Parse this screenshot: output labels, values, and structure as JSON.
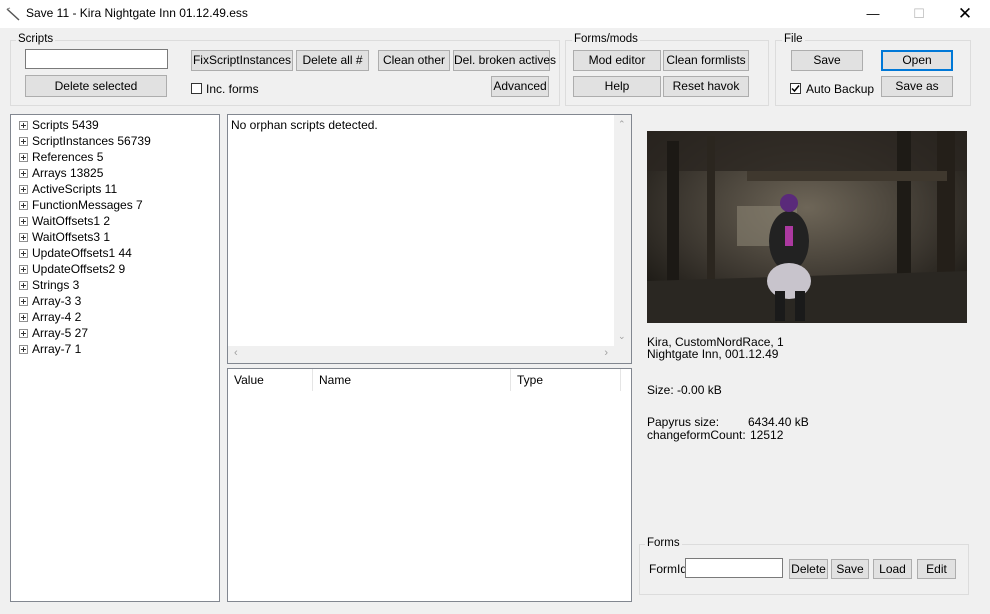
{
  "window": {
    "title": "Save 11 - Kira  Nightgate Inn  01.12.49.ess"
  },
  "scripts_group": {
    "label": "Scripts",
    "filter_value": "",
    "delete_selected": "Delete selected",
    "fix_script_instances": "FixScriptInstances",
    "delete_all": "Delete all #",
    "clean_other": "Clean other",
    "del_broken_actives": "Del. broken actives",
    "inc_forms": "Inc. forms",
    "advanced": "Advanced"
  },
  "formsmods_group": {
    "label": "Forms/mods",
    "mod_editor": "Mod editor",
    "clean_formlists": "Clean formlists",
    "help": "Help",
    "reset_havok": "Reset havok"
  },
  "file_group": {
    "label": "File",
    "save": "Save",
    "open": "Open",
    "auto_backup": "Auto Backup",
    "auto_backup_checked": true,
    "save_as": "Save as"
  },
  "tree": {
    "items": [
      {
        "label": "Scripts 5439"
      },
      {
        "label": "ScriptInstances 56739"
      },
      {
        "label": "References 5"
      },
      {
        "label": "Arrays 13825"
      },
      {
        "label": "ActiveScripts 11"
      },
      {
        "label": "FunctionMessages 7"
      },
      {
        "label": "WaitOffsets1 2"
      },
      {
        "label": "WaitOffsets3 1"
      },
      {
        "label": "UpdateOffsets1 44"
      },
      {
        "label": "UpdateOffsets2 9"
      },
      {
        "label": "Strings 3"
      },
      {
        "label": "Array-3 3"
      },
      {
        "label": "Array-4 2"
      },
      {
        "label": "Array-5 27"
      },
      {
        "label": "Array-7 1"
      }
    ]
  },
  "message": "No orphan scripts detected.",
  "table": {
    "columns": [
      "Value",
      "Name",
      "Type"
    ]
  },
  "save_info": {
    "line1": "Kira, CustomNordRace, 1",
    "line2": "Nightgate Inn, 001.12.49",
    "size": "Size: -0.00 kB",
    "papyrus_label": "Papyrus size:",
    "papyrus_value": "6434.40 kB",
    "changeform_label": "changeformCount:",
    "changeform_value": "12512"
  },
  "forms_group": {
    "label": "Forms",
    "formid_label": "FormId",
    "formid_value": "",
    "delete": "Delete",
    "save": "Save",
    "load": "Load",
    "edit": "Edit"
  }
}
